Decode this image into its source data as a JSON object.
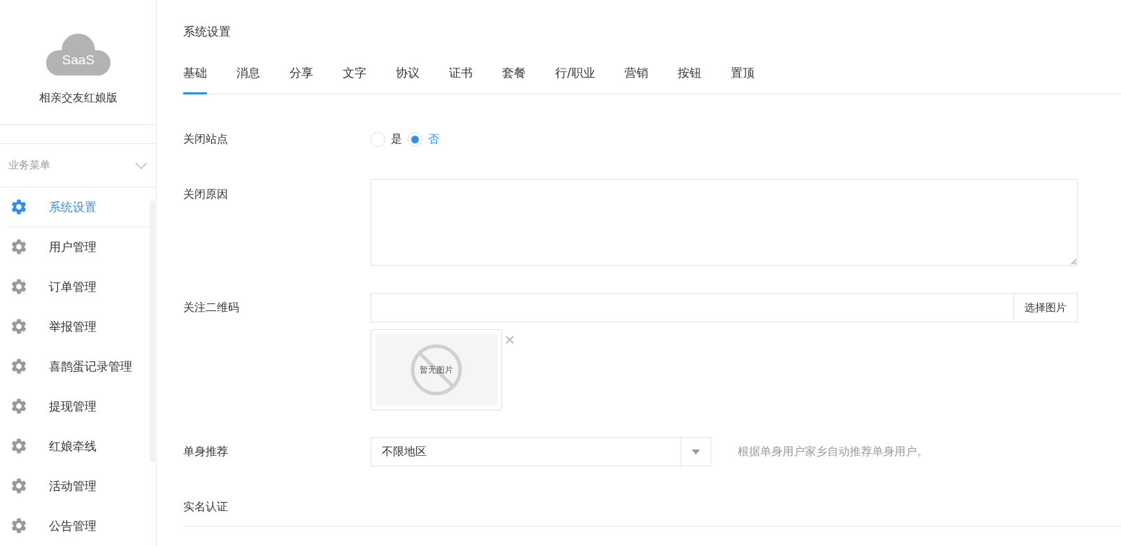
{
  "sidebar": {
    "brand": {
      "logo_text": "SaaS",
      "name": "相亲交友红娘版"
    },
    "group": {
      "label": "业务菜单",
      "expanded": true
    },
    "items": [
      {
        "label": "系统设置",
        "selected": true
      },
      {
        "label": "用户管理",
        "selected": false
      },
      {
        "label": "订单管理",
        "selected": false
      },
      {
        "label": "举报管理",
        "selected": false
      },
      {
        "label": "喜鹊蛋记录管理",
        "selected": false
      },
      {
        "label": "提现管理",
        "selected": false
      },
      {
        "label": "红娘牵线",
        "selected": false
      },
      {
        "label": "活动管理",
        "selected": false
      },
      {
        "label": "公告管理",
        "selected": false
      }
    ]
  },
  "page": {
    "title": "系统设置"
  },
  "tabs": [
    {
      "label": "基础",
      "selected": true
    },
    {
      "label": "消息",
      "selected": false
    },
    {
      "label": "分享",
      "selected": false
    },
    {
      "label": "文字",
      "selected": false
    },
    {
      "label": "协议",
      "selected": false
    },
    {
      "label": "证书",
      "selected": false
    },
    {
      "label": "套餐",
      "selected": false
    },
    {
      "label": "行/职业",
      "selected": false
    },
    {
      "label": "营销",
      "selected": false
    },
    {
      "label": "按钮",
      "selected": false
    },
    {
      "label": "置顶",
      "selected": false
    }
  ],
  "form": {
    "close_site": {
      "label": "关闭站点",
      "options": [
        {
          "label": "是",
          "selected": false
        },
        {
          "label": "否",
          "selected": true
        }
      ]
    },
    "close_reason": {
      "label": "关闭原因"
    },
    "qr_code": {
      "label": "关注二维码",
      "button": "选择图片",
      "image_placeholder": "暂无图片"
    },
    "single_recommend": {
      "label": "单身推荐",
      "value": "不限地区",
      "hint": "根据单身用户家乡自动推荐单身用户。"
    },
    "section": "实名认证"
  }
}
